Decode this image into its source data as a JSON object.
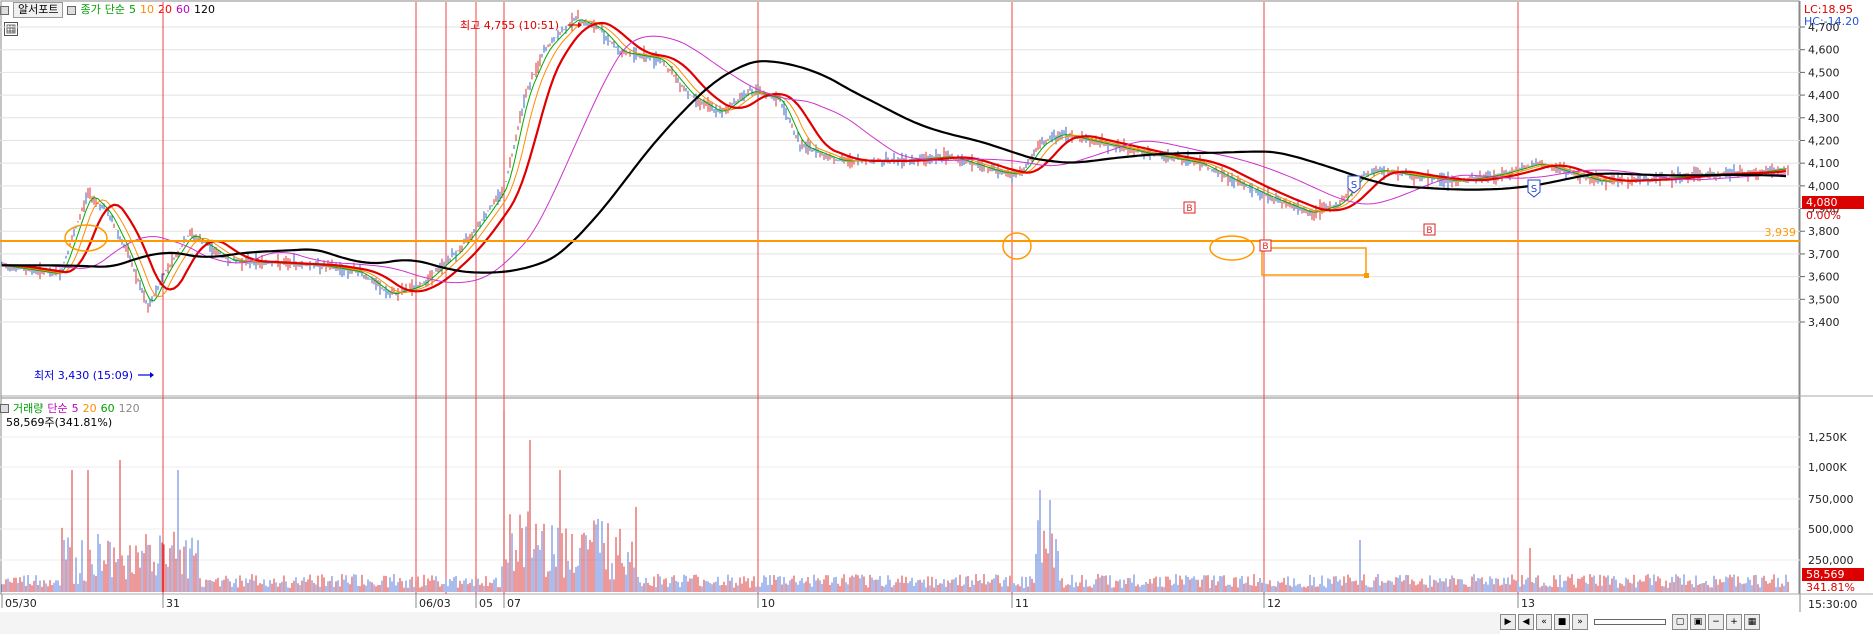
{
  "header": {
    "button_label": "알서포트",
    "price_legend": [
      "종가",
      "단순",
      "5",
      "10",
      "20",
      "60",
      "120"
    ],
    "price_legend_colors": [
      "#00a000",
      "#00a000",
      "#00a000",
      "#ff8c00",
      "#ff0000",
      "#c000c0",
      "#000000"
    ]
  },
  "top_right": {
    "lc": "LC:18.95",
    "hc": "HC:-14.20"
  },
  "annotations": {
    "high": "최고 4,755 (10:51)",
    "low": "최저 3,430 (15:09)",
    "current_price": "4,080",
    "current_pct": "0.00%",
    "support_level": "3,939",
    "signal_s": "S",
    "signal_b": "B"
  },
  "price_axis": [
    "4,700",
    "4,600",
    "4,500",
    "4,400",
    "4,300",
    "4,200",
    "4,100",
    "4,000",
    "3,900",
    "3,800",
    "3,700",
    "3,600",
    "3,500",
    "3,400"
  ],
  "volume": {
    "legend": [
      "거래량",
      "단순",
      "5",
      "20",
      "60",
      "120"
    ],
    "legend_colors": [
      "#00a000",
      "#c000c0",
      "#c000c0",
      "#ff8c00",
      "#00a000",
      "#888888"
    ],
    "summary": "58,569주(341.81%)",
    "axis": [
      "1,250K",
      "1,000K",
      "750,000",
      "500,000",
      "250,000"
    ],
    "current": "58,569",
    "current_pct": "341.81%"
  },
  "x_axis": {
    "labels": [
      "05/30",
      "31",
      "06/03",
      "05",
      "07",
      "10",
      "11",
      "12",
      "13"
    ],
    "time": "15:30:00"
  },
  "icons": {
    "grid": "grid-icon",
    "toolbar": [
      "play-icon",
      "rewind-icon",
      "fast-rewind-icon",
      "stop-icon",
      "fast-forward-icon",
      "zoom-icon",
      "zoom-out-icon",
      "minus-icon",
      "plus-icon",
      "settings-icon"
    ]
  }
}
